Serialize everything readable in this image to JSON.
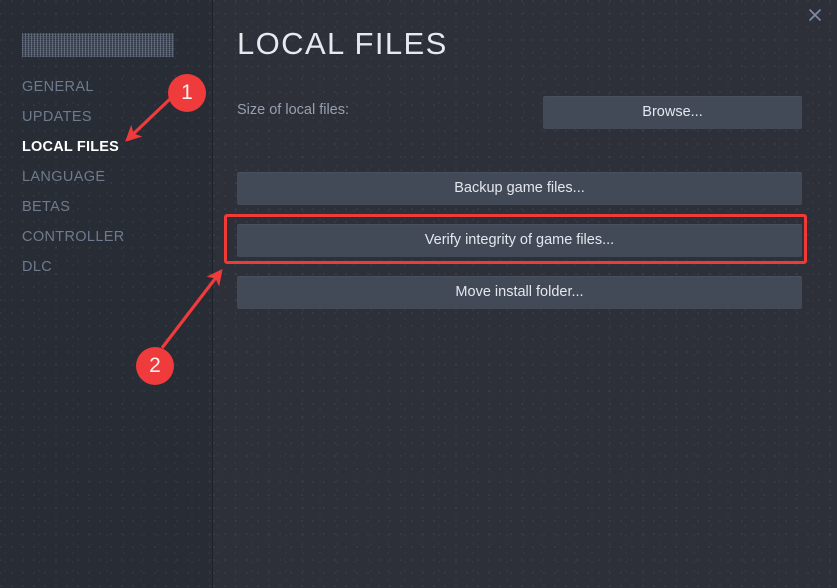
{
  "window": {
    "close_icon": "close-icon"
  },
  "sidebar": {
    "redacted_title": "",
    "items": [
      {
        "label": "GENERAL",
        "active": false
      },
      {
        "label": "UPDATES",
        "active": false
      },
      {
        "label": "LOCAL FILES",
        "active": true
      },
      {
        "label": "LANGUAGE",
        "active": false
      },
      {
        "label": "BETAS",
        "active": false
      },
      {
        "label": "CONTROLLER",
        "active": false
      },
      {
        "label": "DLC",
        "active": false
      }
    ]
  },
  "main": {
    "title": "LOCAL FILES",
    "size_label": "Size of local files:",
    "size_value": "",
    "browse_label": "Browse...",
    "buttons": [
      {
        "label": "Backup game files..."
      },
      {
        "label": "Verify integrity of game files..."
      },
      {
        "label": "Move install folder..."
      }
    ]
  },
  "annotations": {
    "accent_color": "#ef3b3b",
    "markers": [
      {
        "number": "1",
        "points_to": "sidebar-item-local-files"
      },
      {
        "number": "2",
        "points_to": "verify-integrity-button"
      }
    ],
    "highlight_target": "verify-integrity-button"
  },
  "colors": {
    "sidebar_bg": "#282c35",
    "main_bg": "#2d3039",
    "button_bg": "#434a57",
    "text_muted": "#6f7b8d",
    "text_active": "#ffffff",
    "accent_red": "#ef3b3b"
  }
}
